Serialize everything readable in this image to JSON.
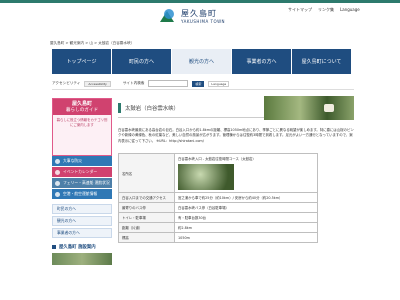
{
  "header": {
    "logo_jp": "屋久島町",
    "logo_en": "YAKUSHIMA TOWN",
    "util_links": [
      "サイトマップ",
      "リンク集",
      "Language"
    ]
  },
  "breadcrumb": "屋久島町 > 観光案内 > 山 > 太鼓岩（白谷雲水峡）",
  "gnav": {
    "items": [
      {
        "label": "トップページ",
        "active": false
      },
      {
        "label": "町民の方へ",
        "active": false
      },
      {
        "label": "観光の方へ",
        "active": true
      },
      {
        "label": "事業者の方へ",
        "active": false
      },
      {
        "label": "屋久島町について",
        "active": false
      }
    ]
  },
  "access": {
    "label": "アクセシビリティ",
    "badge": "Accessibility",
    "search_label": "サイト内検索",
    "search_button": "検索",
    "lang": "Language"
  },
  "sidebar": {
    "card_title_1": "屋久島町",
    "card_title_2": "暮らしのガイド",
    "card_sub": "暮らしに役立つ情報をカテゴリ別にご案内します",
    "items": [
      {
        "label": "大事な防災",
        "color": "#2f78b5"
      },
      {
        "label": "イベントカレンダー",
        "color": "#d0426f"
      },
      {
        "label": "フェリー・高速船 運航状況",
        "color": "#4d7fa8"
      },
      {
        "label": "空港・航空運航情報",
        "color": "#2f78b5"
      }
    ],
    "nav": [
      "町民の方へ",
      "観光の方へ",
      "事業者の方へ"
    ],
    "section_title": "屋久島町 施設案内"
  },
  "main": {
    "title": "太鼓岩（白谷雲水峡）",
    "description": "白谷雲水峡最奥にある高台岩の巨石。白谷入口から約1.8kmの距離、標高1050m地点にあり、季節ごとに異なる眺望が楽しめます。特に春には山桜のピンクや新緑の黄緑色、秋の紅葉など、美しい自然の風景が広がります。管理棟からは往復約3時間で到着します。足元がよい一方通行となっていますので、案内表示に従って下さい。 ※URL：http://shiratani.com/",
    "table": [
      {
        "key": "名所名",
        "value": "白谷雲水峡入口 - 太鼓岩往復時間コース（太鼓岩）",
        "has_photo": true
      },
      {
        "key": "白谷入口までの交通アクセス",
        "value": "宮之浦から車で約25分（約10km）/ 安房から約40分（約20.5km）",
        "has_photo": false
      },
      {
        "key": "最寄りのバス停",
        "value": "白谷雲水峡バス停（白谷駐車場）",
        "has_photo": false
      },
      {
        "key": "トイレ・駐車場",
        "value": "有・駐車台数30台",
        "has_photo": false
      },
      {
        "key": "距離（片道）",
        "value": "約2.8km",
        "has_photo": false
      },
      {
        "key": "標高",
        "value": "1050m",
        "has_photo": false
      }
    ]
  }
}
